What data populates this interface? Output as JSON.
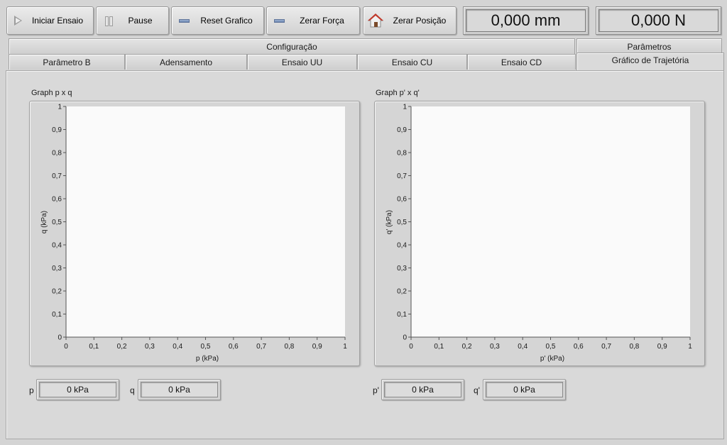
{
  "toolbar": {
    "start_label": "Iniciar Ensaio",
    "pause_label": "Pause",
    "reset_graph_label": "Reset Grafico",
    "zero_force_label": "Zerar Força",
    "zero_position_label": "Zerar Posição"
  },
  "readouts": {
    "displacement": "0,000 mm",
    "force": "0,000 N"
  },
  "tabs_top": [
    {
      "label": "Configuração"
    },
    {
      "label": "Parâmetros"
    }
  ],
  "tabs_bottom": [
    {
      "label": "Parâmetro B"
    },
    {
      "label": "Adensamento"
    },
    {
      "label": "Ensaio UU"
    },
    {
      "label": "Ensaio CU"
    },
    {
      "label": "Ensaio CD"
    },
    {
      "label": "Gráfico de Trajetória"
    }
  ],
  "graphs": [
    {
      "caption": "Graph p x q",
      "xlabel": "p (kPa)",
      "ylabel": "q (kPa)",
      "ticks": [
        "0",
        "0,1",
        "0,2",
        "0,3",
        "0,4",
        "0,5",
        "0,6",
        "0,7",
        "0,8",
        "0,9",
        "1"
      ]
    },
    {
      "caption": "Graph p' x q'",
      "xlabel": "p' (kPa)",
      "ylabel": "q' (kPa)",
      "ticks": [
        "0",
        "0,1",
        "0,2",
        "0,3",
        "0,4",
        "0,5",
        "0,6",
        "0,7",
        "0,8",
        "0,9",
        "1"
      ]
    }
  ],
  "indicators": [
    {
      "label": "p",
      "value": "0 kPa"
    },
    {
      "label": "q",
      "value": "0 kPa"
    },
    {
      "label": "p'",
      "value": "0 kPa"
    },
    {
      "label": "q'",
      "value": "0 kPa"
    }
  ],
  "colors": {
    "background": "#d4d4d4",
    "plot_area": "#fafafa",
    "house_roof": "#c0392b"
  }
}
